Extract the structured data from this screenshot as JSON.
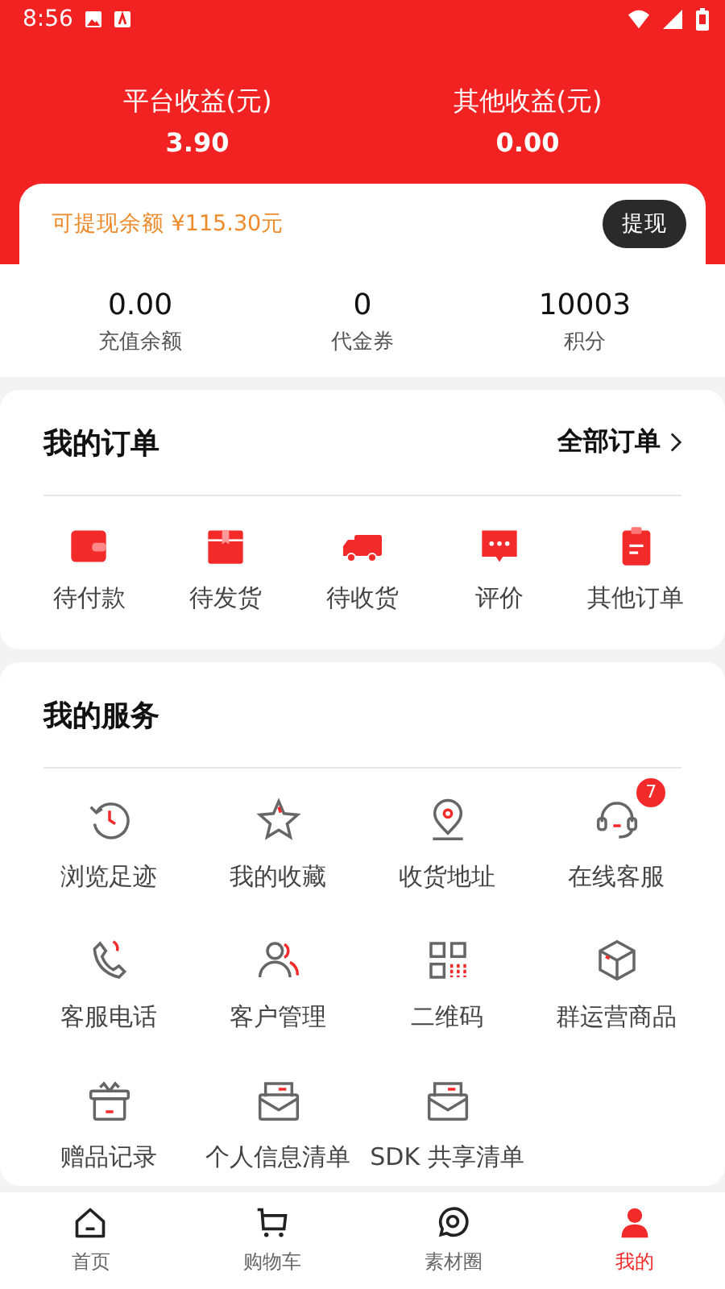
{
  "status_bar": {
    "time": "8:56"
  },
  "earnings": [
    {
      "label": "平台收益(元)",
      "value": "3.90"
    },
    {
      "label": "其他收益(元)",
      "value": "0.00"
    }
  ],
  "withdraw": {
    "balance": "可提现余额 ¥115.30元",
    "button": "提现"
  },
  "stats": [
    {
      "value": "0.00",
      "label": "充值余额"
    },
    {
      "value": "0",
      "label": "代金券"
    },
    {
      "value": "10003",
      "label": "积分"
    }
  ],
  "orders": {
    "title": "我的订单",
    "link": "全部订单",
    "items": [
      {
        "label": "待付款"
      },
      {
        "label": "待发货"
      },
      {
        "label": "待收货"
      },
      {
        "label": "评价"
      },
      {
        "label": "其他订单"
      }
    ]
  },
  "services": {
    "title": "我的服务",
    "items": [
      {
        "label": "浏览足迹"
      },
      {
        "label": "我的收藏"
      },
      {
        "label": "收货地址"
      },
      {
        "label": "在线客服",
        "badge": "7"
      },
      {
        "label": "客服电话"
      },
      {
        "label": "客户管理"
      },
      {
        "label": "二维码"
      },
      {
        "label": "群运营商品"
      },
      {
        "label": "赠品记录"
      },
      {
        "label": "个人信息清单"
      },
      {
        "label": "SDK 共享清单"
      }
    ]
  },
  "tab_bar": [
    {
      "label": "首页",
      "selected": false
    },
    {
      "label": "购物车",
      "selected": false
    },
    {
      "label": "素材圈",
      "selected": false
    },
    {
      "label": "我的",
      "selected": true
    }
  ]
}
